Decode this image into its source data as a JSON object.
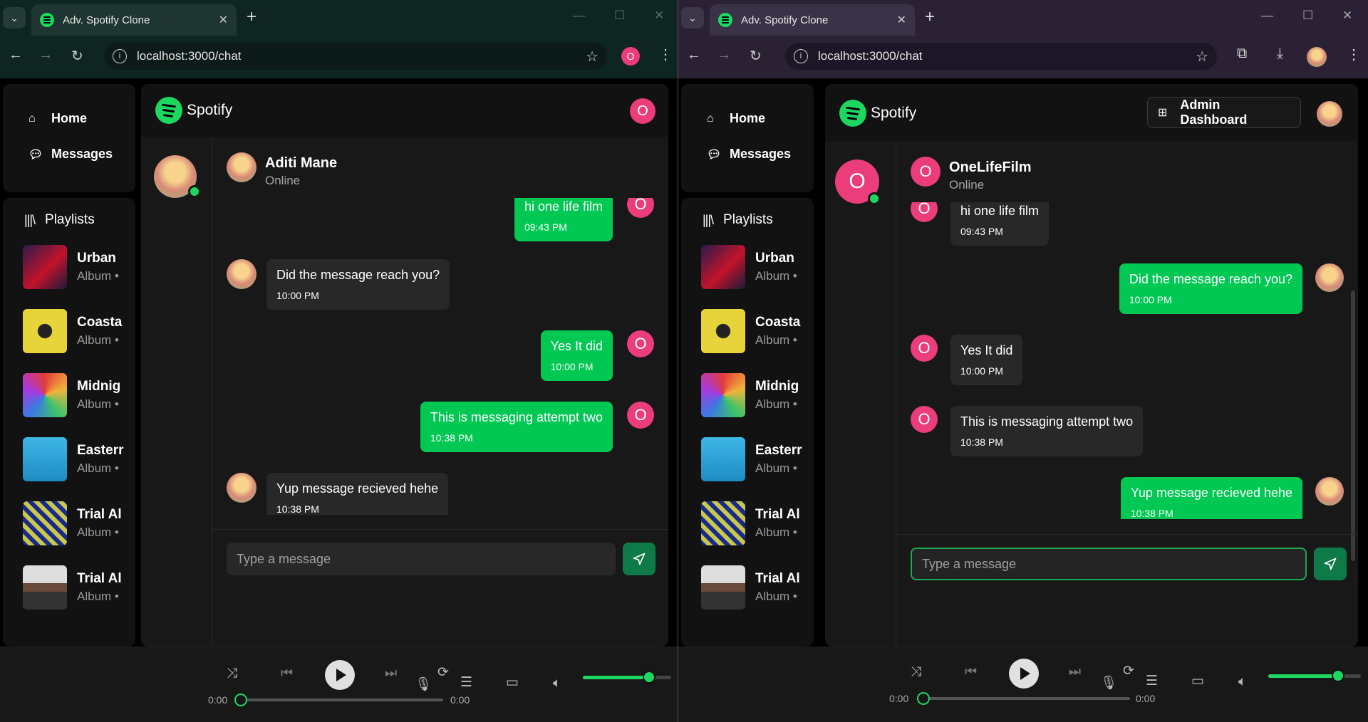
{
  "browser": {
    "tab_title": "Adv. Spotify Clone",
    "url": "localhost:3000/chat",
    "profile_initial": "O",
    "new_tab": "+",
    "close_tab": "✕"
  },
  "app": {
    "brand": "Spotify",
    "nav": {
      "home": "Home",
      "messages": "Messages"
    },
    "playlists_title": "Playlists",
    "playlists": [
      {
        "name": "Urban",
        "sub": "Album •"
      },
      {
        "name": "Coasta",
        "sub": "Album •"
      },
      {
        "name": "Midnig",
        "sub": "Album •"
      },
      {
        "name": "Easterr",
        "sub": "Album •"
      },
      {
        "name": "Trial Al",
        "sub": "Album •"
      },
      {
        "name": "Trial Al",
        "sub": "Album •"
      }
    ],
    "admin_dashboard": "Admin Dashboard",
    "input_placeholder": "Type a message",
    "player": {
      "time_current": "0:00",
      "time_total": "0:00",
      "volume_percent": 75,
      "progress_percent": 0
    }
  },
  "left_chat": {
    "user_initial": "O",
    "contact": {
      "name": "Aditi Mane",
      "status": "Online"
    },
    "messages": [
      {
        "text": "hi one life film",
        "time": "09:43 PM",
        "mine": true
      },
      {
        "text": "Did the message reach you?",
        "time": "10:00 PM",
        "mine": false
      },
      {
        "text": "Yes It did",
        "time": "10:00 PM",
        "mine": true
      },
      {
        "text": "This is messaging attempt two",
        "time": "10:38 PM",
        "mine": true
      },
      {
        "text": "Yup message recieved hehe",
        "time": "10:38 PM",
        "mine": false
      }
    ]
  },
  "right_chat": {
    "contact": {
      "initial": "O",
      "name": "OneLifeFilm",
      "status": "Online"
    },
    "messages": [
      {
        "text": "hi one life film",
        "time": "09:43 PM",
        "mine": false
      },
      {
        "text": "Did the message reach you?",
        "time": "10:00 PM",
        "mine": true
      },
      {
        "text": "Yes It did",
        "time": "10:00 PM",
        "mine": false
      },
      {
        "text": "This is messaging attempt two",
        "time": "10:38 PM",
        "mine": false
      },
      {
        "text": "Yup message recieved hehe",
        "time": "10:38 PM",
        "mine": true
      }
    ]
  },
  "colors": {
    "accent": "#1ed760",
    "bubble_mine": "#00c853",
    "bubble_other": "#282828",
    "avatar_pink": "#ea3d7a"
  }
}
